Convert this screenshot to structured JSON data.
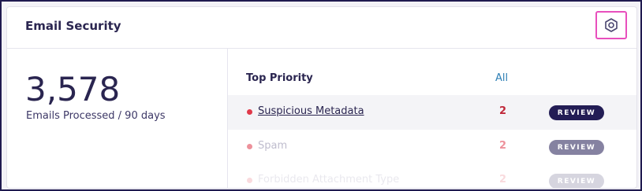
{
  "card": {
    "title": "Email Security",
    "settings_icon": "gear-hexagon-icon"
  },
  "summary": {
    "value": "3,578",
    "caption": "Emails Processed / 90 days"
  },
  "priority": {
    "heading": "Top Priority",
    "all_label": "All",
    "items": [
      {
        "label": "Suspicious Metadata",
        "count": "2",
        "action": "REVIEW",
        "color": "#e0394a"
      },
      {
        "label": "Spam",
        "count": "2",
        "action": "REVIEW",
        "color": "#e0394a"
      },
      {
        "label": "Forbidden Attachment Type",
        "count": "2",
        "action": "REVIEW",
        "color": "#e0394a"
      }
    ]
  },
  "colors": {
    "accent_dark": "#231d55",
    "settings_highlight": "#e84fbd",
    "link": "#2d7fb5",
    "alert": "#e0394a"
  }
}
